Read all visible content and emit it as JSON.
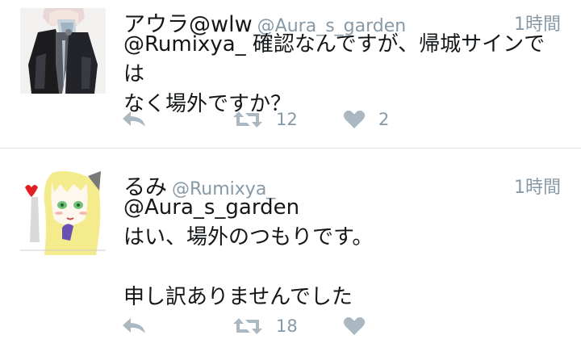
{
  "colors": {
    "text": "#14171a",
    "secondary": "#8899a6",
    "divider": "#dfe3e6",
    "icon": "#aab8c2"
  },
  "tweets": [
    {
      "display_name": "アウラ@wlw",
      "handle": "@Aura_s_garden",
      "time": "1時間",
      "lines": [
        "@Rumixya_ 確認なんですが、帰城サインでは",
        "なく場外ですか？"
      ],
      "retweet_count": "12",
      "like_count": "2"
    },
    {
      "display_name": "るみ",
      "handle": "@Rumixya_",
      "time": "1時間",
      "lines": [
        "@Aura_s_garden",
        "はい、場外のつもりです。",
        "",
        "申し訳ありませんでした"
      ],
      "retweet_count": "18",
      "like_count": ""
    }
  ],
  "icons": {
    "reply": "reply-arrow-icon",
    "retweet": "retweet-icon",
    "like": "heart-icon"
  }
}
